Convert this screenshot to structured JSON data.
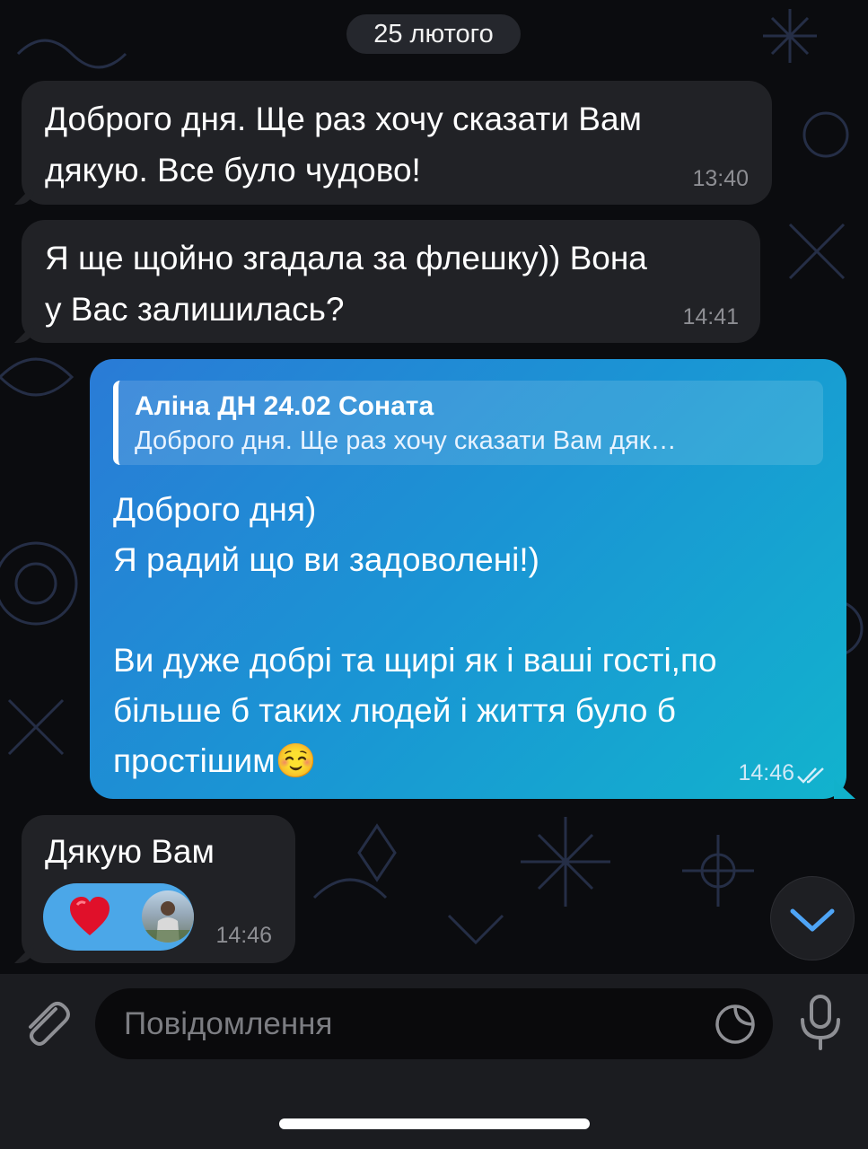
{
  "chat": {
    "date_label": "25 лютого",
    "messages": [
      {
        "direction": "incoming",
        "text": "Доброго дня. Ще раз хочу сказати Вам\nдякую. Все було чудово!",
        "time": "13:40"
      },
      {
        "direction": "incoming",
        "text": "Я ще щойно згадала за флешку)) Вона\nу Вас залишилась?",
        "time": "14:41"
      },
      {
        "direction": "outgoing",
        "reply": {
          "name": "Аліна ДН 24.02 Соната",
          "snippet": "Доброго дня. Ще раз хочу сказати Вам дяк…"
        },
        "text": "Доброго дня)\nЯ радий що ви задоволені!)\n\nВи дуже добрі та щирі як і ваші гості,по\nбільше б таких людей і життя було б\nпростішим☺️",
        "time": "14:46",
        "status": "read"
      },
      {
        "direction": "incoming",
        "text": "Дякую Вам",
        "time": "14:46",
        "reaction": {
          "emoji": "❤️",
          "icon": "heart-icon"
        }
      }
    ]
  },
  "composer": {
    "placeholder": "Повідомлення",
    "attach_icon": "paperclip-icon",
    "sticker_icon": "sticker-icon",
    "mic_icon": "microphone-icon"
  },
  "scroll_down_icon": "chevron-down-icon",
  "colors": {
    "background": "#0b0c0f",
    "incoming_bubble": "#212226",
    "outgoing_gradient_start": "#2a7bd6",
    "outgoing_gradient_end": "#12b3cd",
    "reaction_bg": "#4ba7e8",
    "accent": "#4ea4f6"
  }
}
